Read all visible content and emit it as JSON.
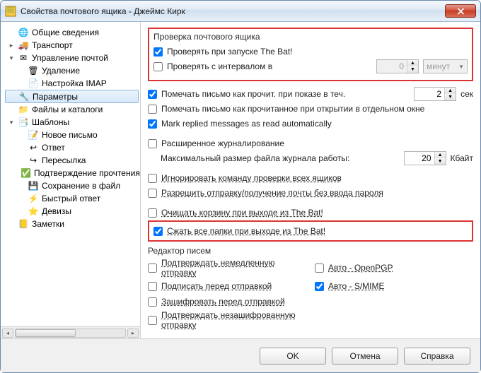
{
  "window": {
    "title": "Свойства почтового ящика - Джеймс Кирк"
  },
  "tree": {
    "items": [
      {
        "label": "Общие сведения",
        "level": 0,
        "icon": "world"
      },
      {
        "label": "Транспорт",
        "level": 0,
        "icon": "car",
        "exp": "closed"
      },
      {
        "label": "Управление почтой",
        "level": 0,
        "icon": "envelope",
        "exp": "open"
      },
      {
        "label": "Удаление",
        "level": 1,
        "icon": "trash"
      },
      {
        "label": "Настройка IMAP",
        "level": 1,
        "icon": "page"
      },
      {
        "label": "Параметры",
        "level": 0,
        "icon": "gear",
        "selected": true
      },
      {
        "label": "Файлы и каталоги",
        "level": 0,
        "icon": "folder"
      },
      {
        "label": "Шаблоны",
        "level": 0,
        "icon": "templates",
        "exp": "open"
      },
      {
        "label": "Новое письмо",
        "level": 1,
        "icon": "newmail"
      },
      {
        "label": "Ответ",
        "level": 1,
        "icon": "reply"
      },
      {
        "label": "Пересылка",
        "level": 1,
        "icon": "forward"
      },
      {
        "label": "Подтверждение прочтения",
        "level": 1,
        "icon": "confirm"
      },
      {
        "label": "Сохранение в файл",
        "level": 1,
        "icon": "save"
      },
      {
        "label": "Быстрый ответ",
        "level": 1,
        "icon": "flash"
      },
      {
        "label": "Девизы",
        "level": 1,
        "icon": "motto"
      },
      {
        "label": "Заметки",
        "level": 0,
        "icon": "note"
      }
    ]
  },
  "check_group": {
    "title": "Проверка почтового ящика",
    "check_on_start": "Проверять при запуске The Bat!",
    "check_on_start_checked": true,
    "check_interval": "Проверять с интервалом в",
    "check_interval_checked": false,
    "interval_value": "0",
    "interval_unit": "минут"
  },
  "opts": {
    "mark_read_after": "Помечать письмо как прочит. при показе в теч.",
    "mark_read_after_checked": true,
    "mark_read_after_value": "2",
    "mark_read_after_unit": "сек",
    "mark_read_on_open": "Помечать письмо как прочитанное при открытии в отдельном окне",
    "mark_read_on_open_checked": false,
    "mark_replied": "Mark replied messages as read automatically",
    "mark_replied_checked": true,
    "ext_logging": "Расширенное журналирование",
    "ext_logging_checked": false,
    "max_log_label": "Максимальный размер файла журнала работы:",
    "max_log_value": "20",
    "max_log_unit": "Кбайт",
    "ignore_check_cmd": "Игнорировать команду проверки всех ящиков",
    "ignore_check_cmd_checked": false,
    "allow_nopass": "Разрешить отправку/получение почты без ввода пароля",
    "allow_nopass_checked": false,
    "empty_trash": "Очищать корзину при выходе из The Bat!",
    "empty_trash_checked": false,
    "compact_folders": "Сжать все папки при выходе из The Bat!",
    "compact_folders_checked": true
  },
  "editor": {
    "title": "Редактор писем",
    "confirm_immediate": "Подтверждать немедленную отправку",
    "confirm_immediate_checked": false,
    "auto_openpgp": "Авто - OpenPGP",
    "auto_openpgp_checked": false,
    "sign_before": "Подписать перед отправкой",
    "sign_before_checked": false,
    "auto_smime": "Авто - S/MIME",
    "auto_smime_checked": true,
    "encrypt_before": "Зашифровать перед отправкой",
    "encrypt_before_checked": false,
    "confirm_unenc": "Подтверждать незашифрованную отправку",
    "confirm_unenc_checked": false
  },
  "buttons": {
    "ok": "OK",
    "cancel": "Отмена",
    "help": "Справка"
  },
  "icons": {
    "world": "🌐",
    "car": "🚚",
    "envelope": "✉",
    "trash": "🗑",
    "page": "📄",
    "gear": "🔧",
    "folder": "📁",
    "templates": "📑",
    "newmail": "📝",
    "reply": "↩",
    "forward": "↪",
    "confirm": "✅",
    "save": "💾",
    "flash": "⚡",
    "motto": "⭐",
    "note": "📒"
  }
}
